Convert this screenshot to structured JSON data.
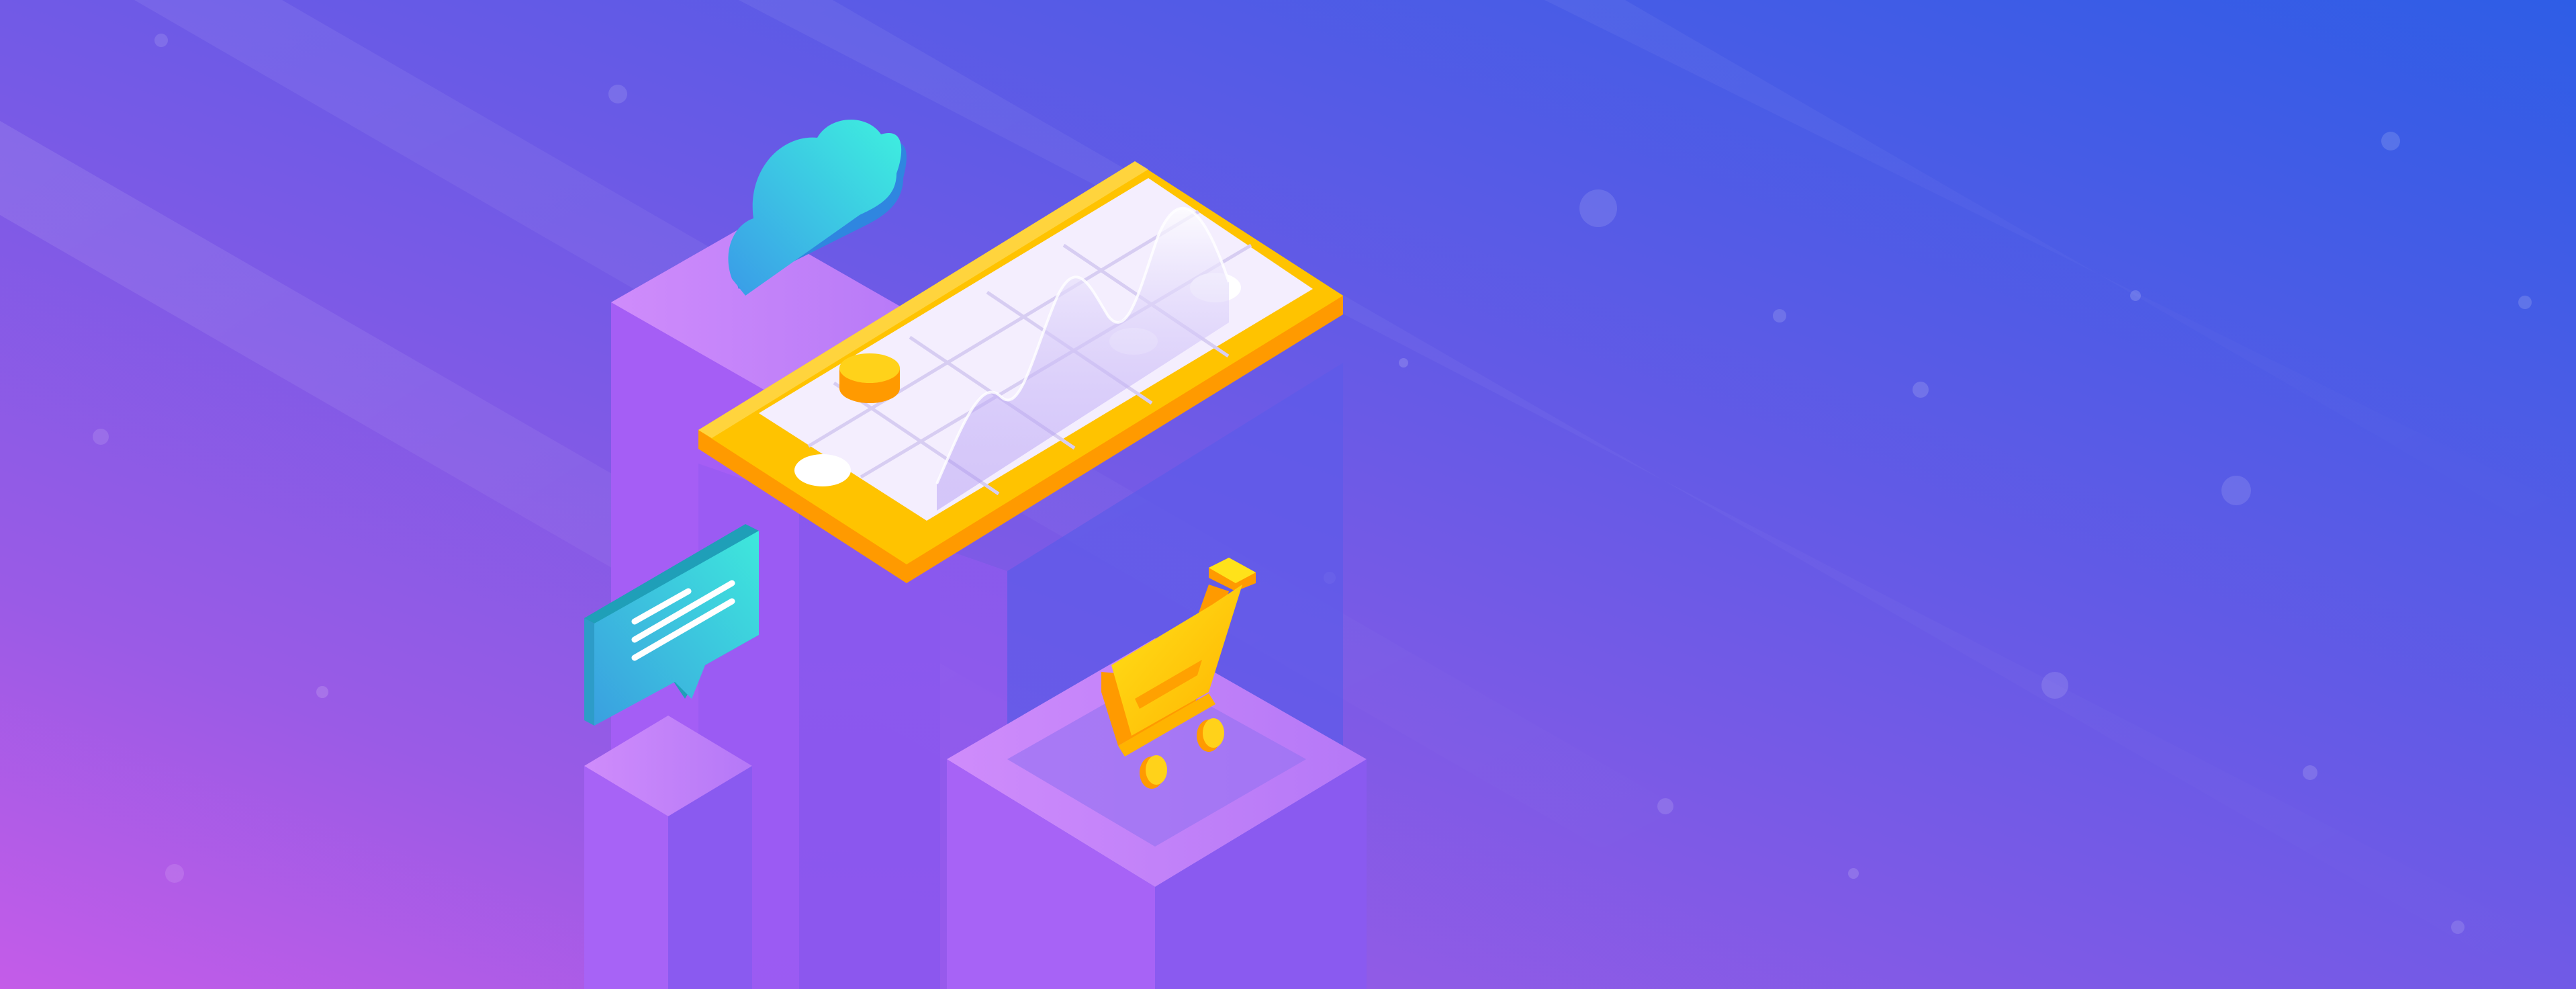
{
  "banner": {
    "colors": {
      "bg_top_right": "#2e5de6",
      "bg_center": "#7a5be6",
      "bg_bottom_left": "#c45ce8",
      "pillar_light": "#c58af8",
      "pillar_mid": "#a866f5",
      "pillar_dark": "#8a55ee",
      "phone_body": "#ffc300",
      "phone_edge": "#ff9a00",
      "phone_screen": "#f4eefe",
      "cloud_start": "#3de8e0",
      "cloud_end": "#3aa6e8",
      "chat_bubble": "#3ccfe0",
      "cart": "#ffc400"
    },
    "icons": [
      "cloud-icon",
      "smartphone-icon",
      "chat-bubble-icon",
      "shopping-cart-icon",
      "coin-icon",
      "wave-chart-icon"
    ]
  }
}
